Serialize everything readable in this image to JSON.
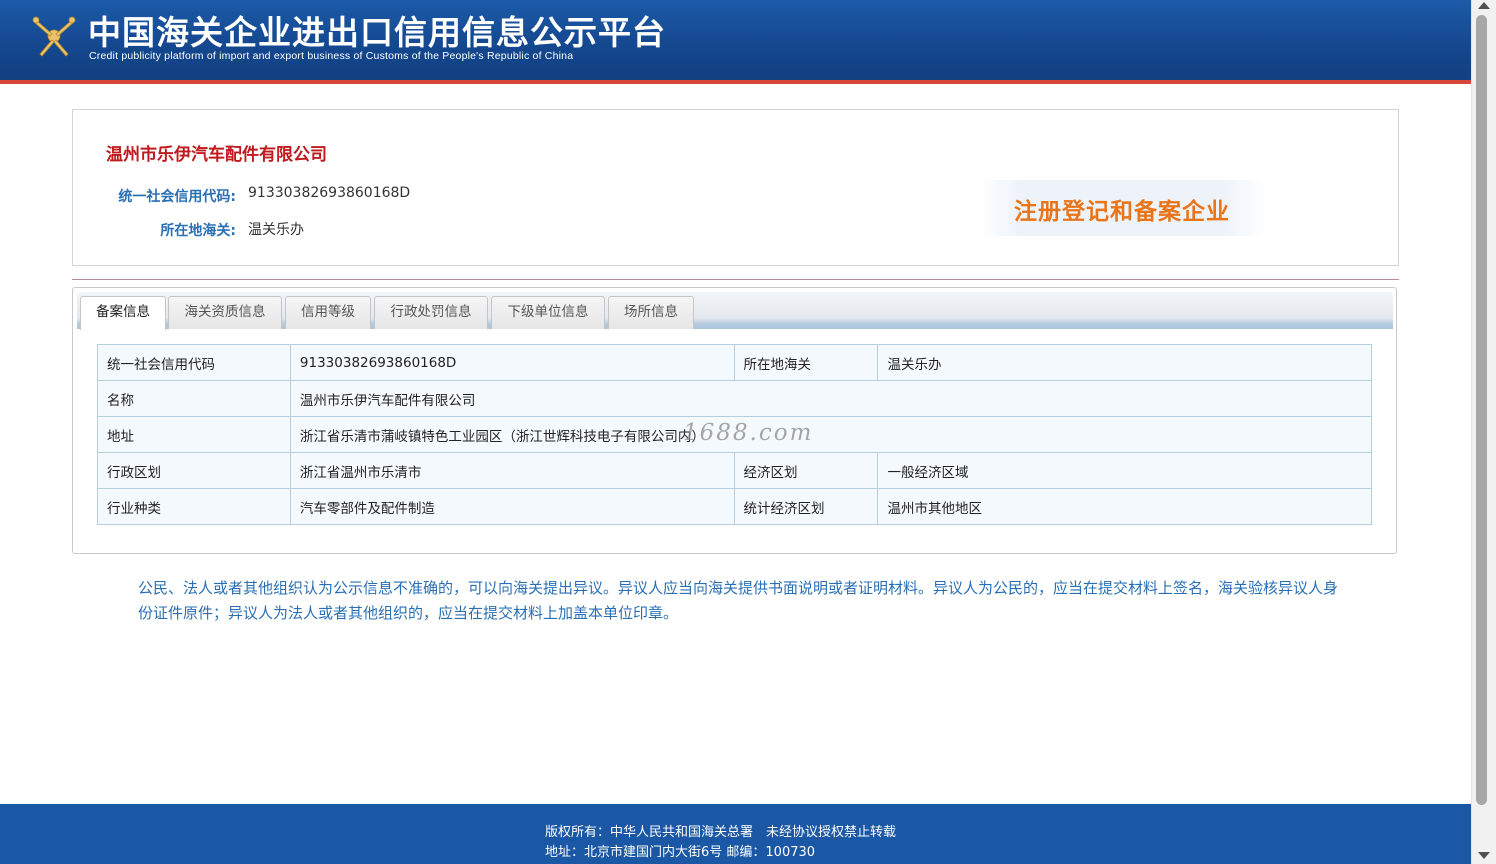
{
  "header": {
    "title": "中国海关企业进出口信用信息公示平台",
    "subtitle": "Credit publicity platform of import and export business of Customs of the People's Republic of China",
    "logo_icon": "customs-emblem-icon"
  },
  "company": {
    "name": "温州市乐伊汽车配件有限公司",
    "credit_code_label": "统一社会信用代码:",
    "credit_code": "91330382693860168D",
    "customs_label": "所在地海关:",
    "customs": "温关乐办",
    "status": "注册登记和备案企业"
  },
  "tabs": [
    {
      "label": "备案信息",
      "active": true
    },
    {
      "label": "海关资质信息",
      "active": false
    },
    {
      "label": "信用等级",
      "active": false
    },
    {
      "label": "行政处罚信息",
      "active": false
    },
    {
      "label": "下级单位信息",
      "active": false
    },
    {
      "label": "场所信息",
      "active": false
    }
  ],
  "details": {
    "row1": {
      "label1": "统一社会信用代码",
      "value1": "91330382693860168D",
      "label2": "所在地海关",
      "value2": "温关乐办"
    },
    "row2": {
      "label1": "名称",
      "value1": "温州市乐伊汽车配件有限公司"
    },
    "row3": {
      "label1": "地址",
      "value1": "浙江省乐清市蒲岐镇特色工业园区（浙江世辉科技电子有限公司内）"
    },
    "row4": {
      "label1": "行政区划",
      "value1": "浙江省温州市乐清市",
      "label2": "经济区划",
      "value2": "一般经济区域"
    },
    "row5": {
      "label1": "行业种类",
      "value1": "汽车零部件及配件制造",
      "label2": "统计经济区划",
      "value2": "温州市其他地区"
    }
  },
  "watermark": "1688.com",
  "notice": "公民、法人或者其他组织认为公示信息不准确的，可以向海关提出异议。异议人应当向海关提供书面说明或者证明材料。异议人为公民的，应当在提交材料上签名，海关验核异议人身份证件原件；异议人为法人或者其他组织的，应当在提交材料上加盖本单位印章。",
  "footer": {
    "copyright": "版权所有：中华人民共和国海关总署　未经协议授权禁止转载",
    "address": "地址：北京市建国门内大街6号 邮编：100730"
  },
  "colors": {
    "header_blue": "#1a57a5",
    "accent_red": "#c0191e",
    "label_blue": "#2a6fb5",
    "status_orange": "#e8751a"
  }
}
